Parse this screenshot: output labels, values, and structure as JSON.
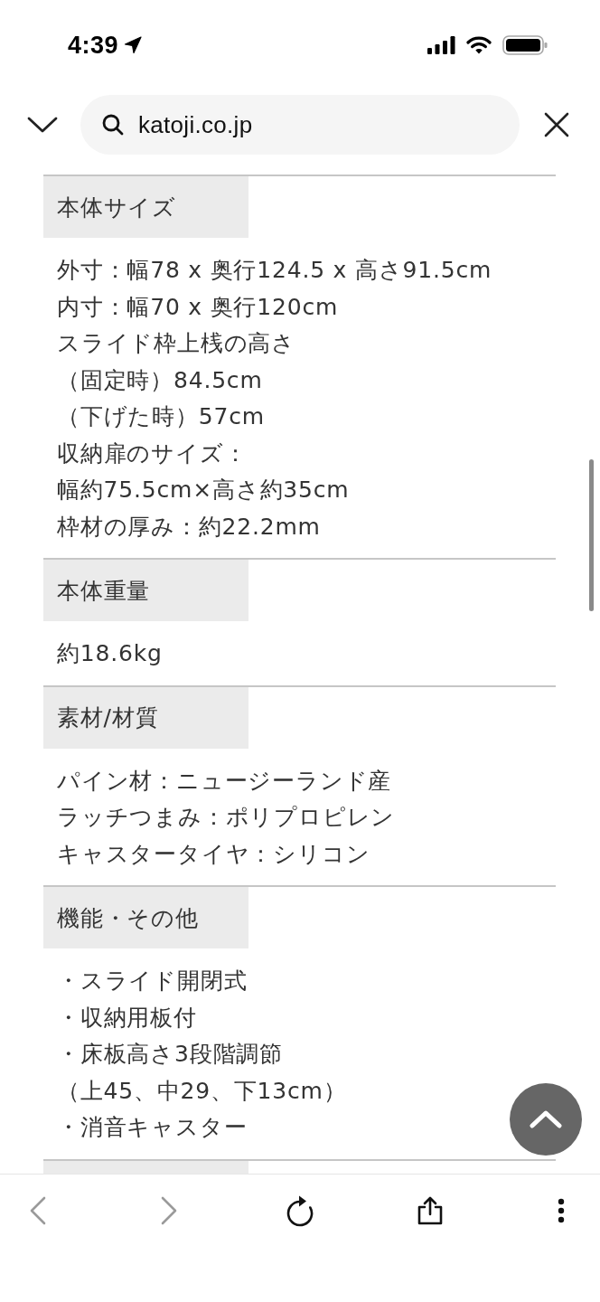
{
  "status_bar": {
    "time": "4:39"
  },
  "address_bar": {
    "url": "katoji.co.jp"
  },
  "spec_sections": [
    {
      "heading": "本体サイズ",
      "lines": [
        "外寸：幅78 x 奥行124.5 x 高さ91.5cm",
        "内寸：幅70 x 奥行120cm",
        "スライド枠上桟の高さ",
        "（固定時）84.5cm",
        "（下げた時）57cm",
        "収納扉のサイズ：",
        "幅約75.5cm×高さ約35cm",
        "枠材の厚み：約22.2mm"
      ]
    },
    {
      "heading": "本体重量",
      "lines": [
        "約18.6kg"
      ]
    },
    {
      "heading": "素材/材質",
      "lines": [
        "パイン材：ニュージーランド産",
        "ラッチつまみ：ポリプロピレン",
        "キャスタータイヤ：シリコン"
      ]
    },
    {
      "heading": "機能・その他",
      "lines": [
        "・スライド開閉式",
        "・収納用板付",
        "・床板高さ3段階調節",
        "（上45、中29、下13cm）",
        "・消音キャスター"
      ]
    }
  ],
  "toolbar": {
    "buttons": [
      {
        "kind": "back",
        "disabled": true
      },
      {
        "kind": "forward",
        "disabled": true
      },
      {
        "kind": "reload",
        "disabled": false
      },
      {
        "kind": "share",
        "disabled": false
      },
      {
        "kind": "more",
        "disabled": false
      }
    ]
  }
}
